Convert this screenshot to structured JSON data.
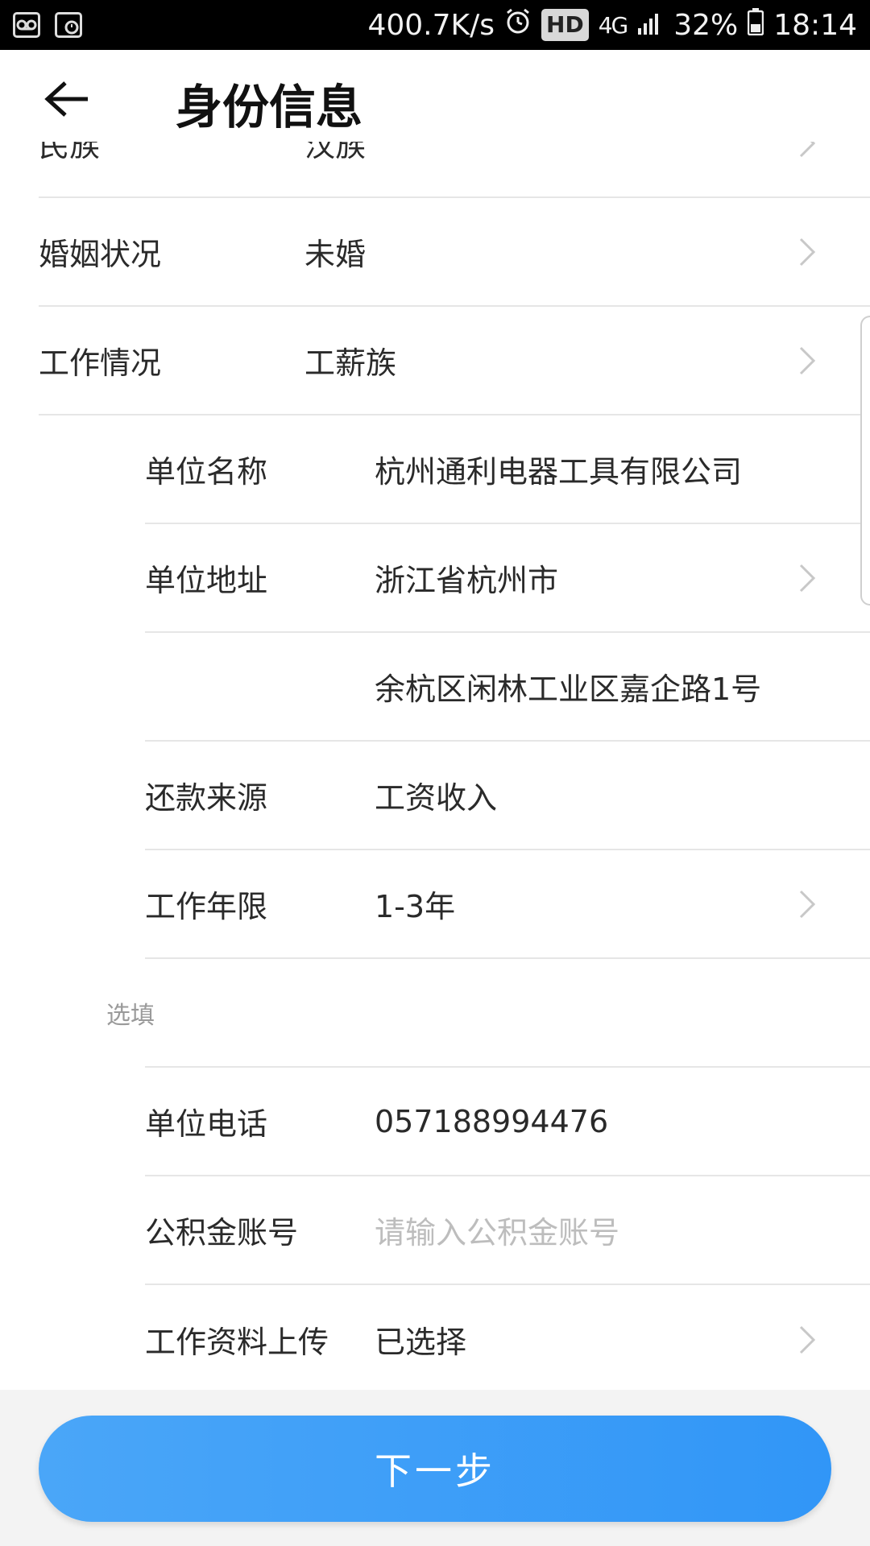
{
  "status_bar": {
    "speed": "400.7K/s",
    "hd": "HD",
    "network": "4G",
    "battery": "32%",
    "time": "18:14"
  },
  "header": {
    "title": "身份信息"
  },
  "rows_top": [
    {
      "label": "民族",
      "value": "汉族"
    },
    {
      "label": "婚姻状况",
      "value": "未婚"
    },
    {
      "label": "工作情况",
      "value": "工薪族"
    }
  ],
  "rows_sub": [
    {
      "label": "单位名称",
      "value": "杭州通利电器工具有限公司"
    },
    {
      "label": "单位地址",
      "value": "浙江省杭州市"
    },
    {
      "label": "",
      "value": "余杭区闲林工业区嘉企路1号"
    },
    {
      "label": "还款来源",
      "value": "工资收入"
    },
    {
      "label": "工作年限",
      "value": "1-3年"
    }
  ],
  "optional_hint": "选填",
  "rows_optional": [
    {
      "label": "单位电话",
      "value": "057188994476"
    },
    {
      "label": "公积金账号",
      "placeholder": "请输入公积金账号"
    },
    {
      "label": "工作资料上传",
      "value": "已选择"
    }
  ],
  "footer": {
    "next_label": "下一步"
  },
  "colors": {
    "accent": "#3196f7",
    "divider": "#e6e6e6",
    "placeholder": "#bdbdbd"
  }
}
